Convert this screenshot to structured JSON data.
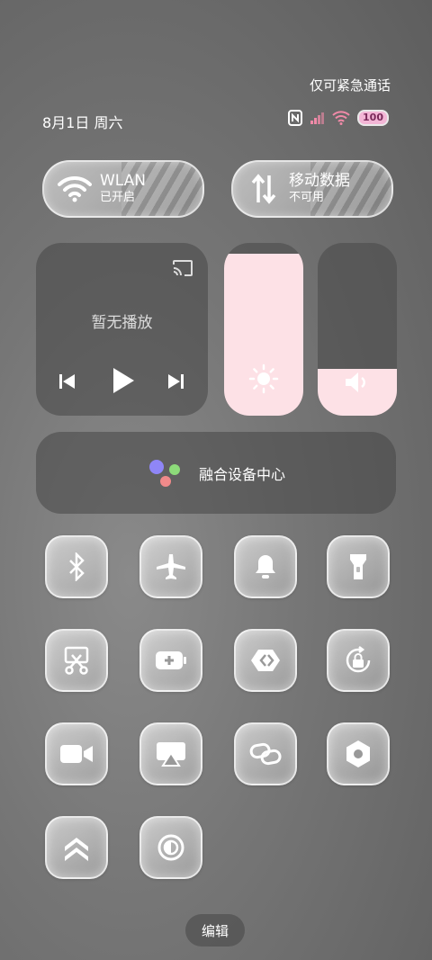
{
  "status_bar": {
    "emergency_text": "仅可紧急通话",
    "date": "8月1日 周六",
    "battery": "100"
  },
  "wlan": {
    "title": "WLAN",
    "status": "已开启"
  },
  "mobile_data": {
    "title": "移动数据",
    "status": "不可用"
  },
  "media": {
    "empty_text": "暂无播放"
  },
  "brightness": {
    "level_fraction": 0.94
  },
  "volume": {
    "level_fraction": 0.27
  },
  "fusion_center": {
    "label": "融合设备中心"
  },
  "toggles": [
    {
      "name": "bluetooth",
      "icon": "bluetooth-icon"
    },
    {
      "name": "airplane-mode",
      "icon": "airplane-icon"
    },
    {
      "name": "notifications",
      "icon": "bell-icon"
    },
    {
      "name": "flashlight",
      "icon": "flashlight-icon"
    },
    {
      "name": "screenshot",
      "icon": "scissors-icon"
    },
    {
      "name": "battery-saver",
      "icon": "battery-icon"
    },
    {
      "name": "nfc-share",
      "icon": "share-arrow-icon"
    },
    {
      "name": "rotation-lock",
      "icon": "rotation-lock-icon"
    },
    {
      "name": "screen-record",
      "icon": "video-camera-icon"
    },
    {
      "name": "screen-cast",
      "icon": "cast-screen-icon"
    },
    {
      "name": "link-share",
      "icon": "link-icon"
    },
    {
      "name": "settings",
      "icon": "hexagon-gear-icon"
    },
    {
      "name": "performance",
      "icon": "chevrons-up-icon"
    },
    {
      "name": "contrast",
      "icon": "contrast-icon"
    }
  ],
  "edit_button": {
    "label": "编辑"
  },
  "colors": {
    "slider_fill": "#fde1e6",
    "battery_badge": "#f3b6d6",
    "wifi_status": "#f08aa8"
  }
}
